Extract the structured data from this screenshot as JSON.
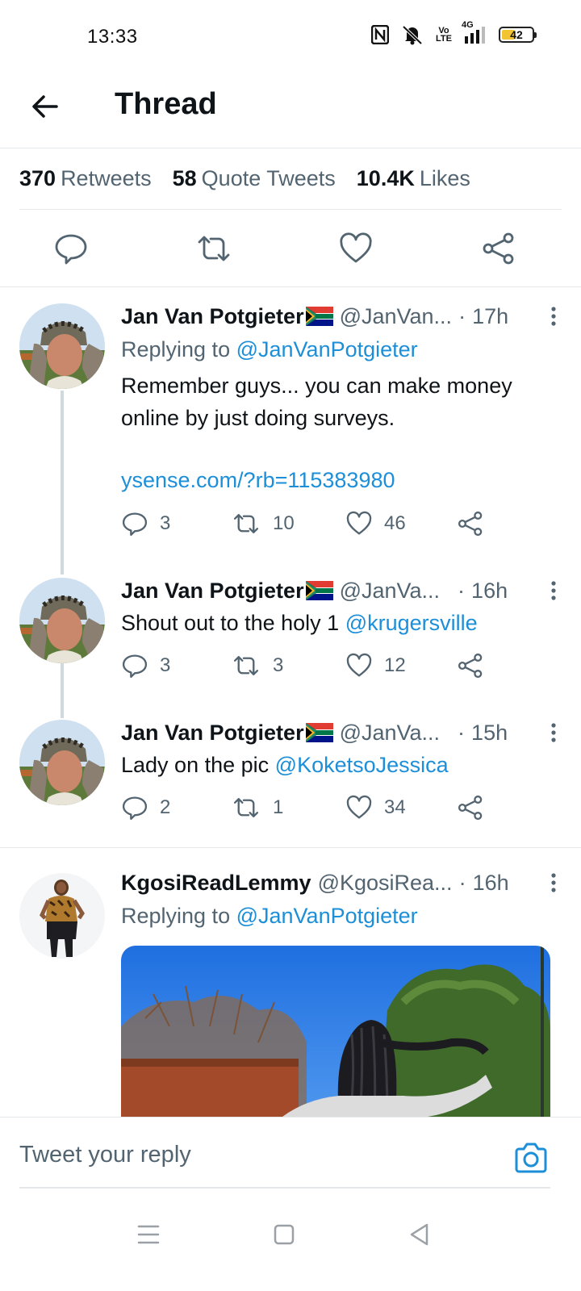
{
  "status_bar": {
    "time": "13:33",
    "nfc_icon": "nfc-icon",
    "silent_icon": "bell-off-icon",
    "volte_line1": "Vo",
    "volte_line2": "LTE",
    "network_label": "4G",
    "battery_level": "42"
  },
  "header": {
    "back_icon": "arrow-left-icon",
    "title": "Thread"
  },
  "stats": [
    {
      "value": "370",
      "label": "Retweets"
    },
    {
      "value": "58",
      "label": "Quote Tweets"
    },
    {
      "value": "10.4K",
      "label": "Likes"
    }
  ],
  "actions": [
    "reply-icon",
    "retweet-icon",
    "like-icon",
    "share-icon"
  ],
  "tweets": [
    {
      "name": "Jan Van Potgieter",
      "handle": "@JanVan...",
      "dot": "·",
      "time": "17h",
      "replying_prefix": "Replying to",
      "replying_handle": "@JanVanPotgieter",
      "text": "Remember guys... you can make money online by just doing surveys.",
      "link": "ysense.com/?rb=115383980",
      "replies": "3",
      "retweets": "10",
      "likes": "46"
    },
    {
      "name": "Jan Van Potgieter",
      "handle": "@JanVa...",
      "dot": "·",
      "time": "16h",
      "text_prefix": "Shout out to the holy 1",
      "mention": "@krugersville",
      "replies": "3",
      "retweets": "3",
      "likes": "12"
    },
    {
      "name": "Jan Van Potgieter",
      "handle": "@JanVa...",
      "dot": "·",
      "time": "15h",
      "text_prefix": "Lady on the pic",
      "mention": "@KoketsoJessica",
      "replies": "2",
      "retweets": "1",
      "likes": "34"
    },
    {
      "name": "KgosiReadLemmy",
      "handle": "@KgosiRea...",
      "dot": "·",
      "time": "16h",
      "replying_prefix": "Replying to",
      "replying_handle": "@JanVanPotgieter"
    }
  ],
  "reply_bar": {
    "placeholder": "Tweet your reply",
    "camera_icon": "camera-icon"
  },
  "nav": [
    "menu-icon",
    "home-square-icon",
    "back-triangle-icon"
  ],
  "colors": {
    "link_blue": "#1d8fd8",
    "secondary_text": "#536471",
    "thread_line": "#cfd9de",
    "battery_yellow": "#f3c431"
  }
}
